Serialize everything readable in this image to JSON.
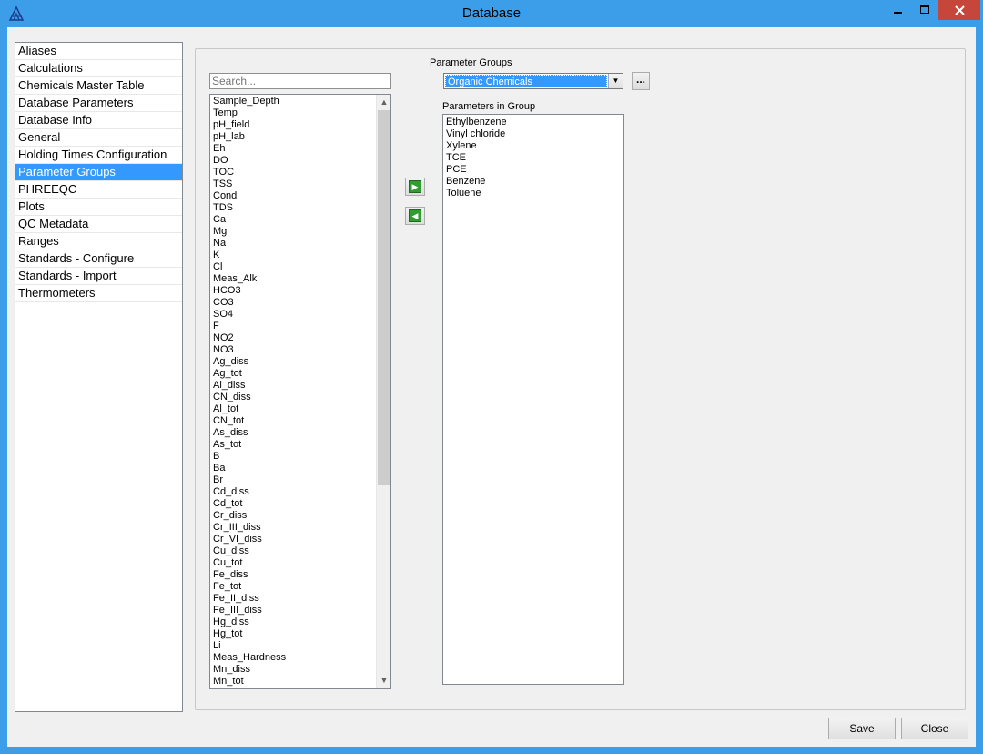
{
  "window": {
    "title": "Database",
    "minimize": "▁",
    "maximize": "☐",
    "close": "✕"
  },
  "nav": {
    "items": [
      "Aliases",
      "Calculations",
      "Chemicals Master Table",
      "Database Parameters",
      "Database Info",
      "General",
      "Holding Times Configuration",
      "Parameter Groups",
      "PHREEQC",
      "Plots",
      "QC Metadata",
      "Ranges",
      "Standards - Configure",
      "Standards - Import",
      "Thermometers"
    ],
    "selected_index": 7
  },
  "search": {
    "placeholder": "Search..."
  },
  "parameters": [
    "Sample_Depth",
    "Temp",
    "pH_field",
    "pH_lab",
    "Eh",
    "DO",
    "TOC",
    "TSS",
    "Cond",
    "TDS",
    "Ca",
    "Mg",
    "Na",
    "K",
    "Cl",
    "Meas_Alk",
    "HCO3",
    "CO3",
    "SO4",
    "F",
    "NO2",
    "NO3",
    "Ag_diss",
    "Ag_tot",
    "Al_diss",
    "CN_diss",
    "Al_tot",
    "CN_tot",
    "As_diss",
    "As_tot",
    "B",
    "Ba",
    "Br",
    "Cd_diss",
    "Cd_tot",
    "Cr_diss",
    "Cr_III_diss",
    "Cr_VI_diss",
    "Cu_diss",
    "Cu_tot",
    "Fe_diss",
    "Fe_tot",
    "Fe_II_diss",
    "Fe_III_diss",
    "Hg_diss",
    "Hg_tot",
    "Li",
    "Meas_Hardness",
    "Mn_diss",
    "Mn_tot"
  ],
  "parameter_groups": {
    "label": "Parameter Groups",
    "selected": "Organic Chemicals",
    "more_label": "..."
  },
  "parameters_in_group": {
    "label": "Parameters in Group",
    "items": [
      "Ethylbenzene",
      "Vinyl chloride",
      "Xylene",
      "TCE",
      "PCE",
      "Benzene",
      "Toluene"
    ]
  },
  "buttons": {
    "save": "Save",
    "close": "Close"
  },
  "colors": {
    "selection": "#3399ff",
    "titlebar": "#3c9ee8",
    "close_button": "#c7463b"
  }
}
